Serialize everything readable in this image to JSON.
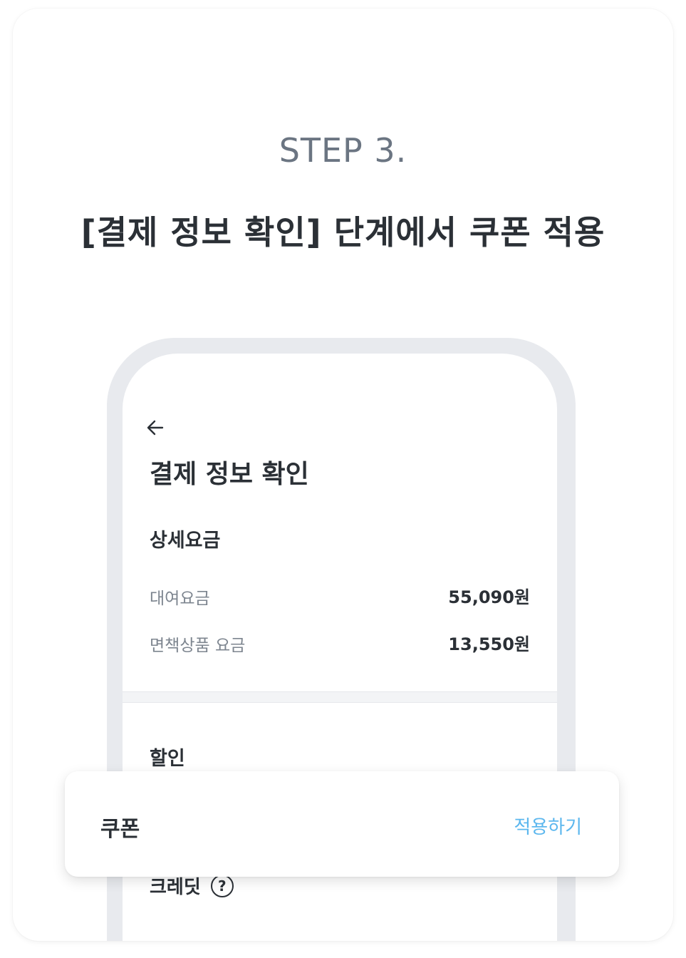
{
  "header": {
    "step_label": "STEP 3.",
    "title": "[결제 정보 확인] 단계에서 쿠폰 적용"
  },
  "screen": {
    "title": "결제 정보 확인",
    "detail_section": {
      "heading": "상세요금",
      "rows": [
        {
          "label": "대여요금",
          "value": "55,090원"
        },
        {
          "label": "면책상품 요금",
          "value": "13,550원"
        }
      ]
    },
    "discount_section": {
      "heading": "할인",
      "credit_label": "크레딧",
      "help_glyph": "?"
    }
  },
  "coupon_card": {
    "label": "쿠폰",
    "action_label": "적용하기",
    "action_color": "#5cb7ee"
  },
  "icons": {
    "back": "arrow-left-icon",
    "help": "question-circle-icon"
  }
}
